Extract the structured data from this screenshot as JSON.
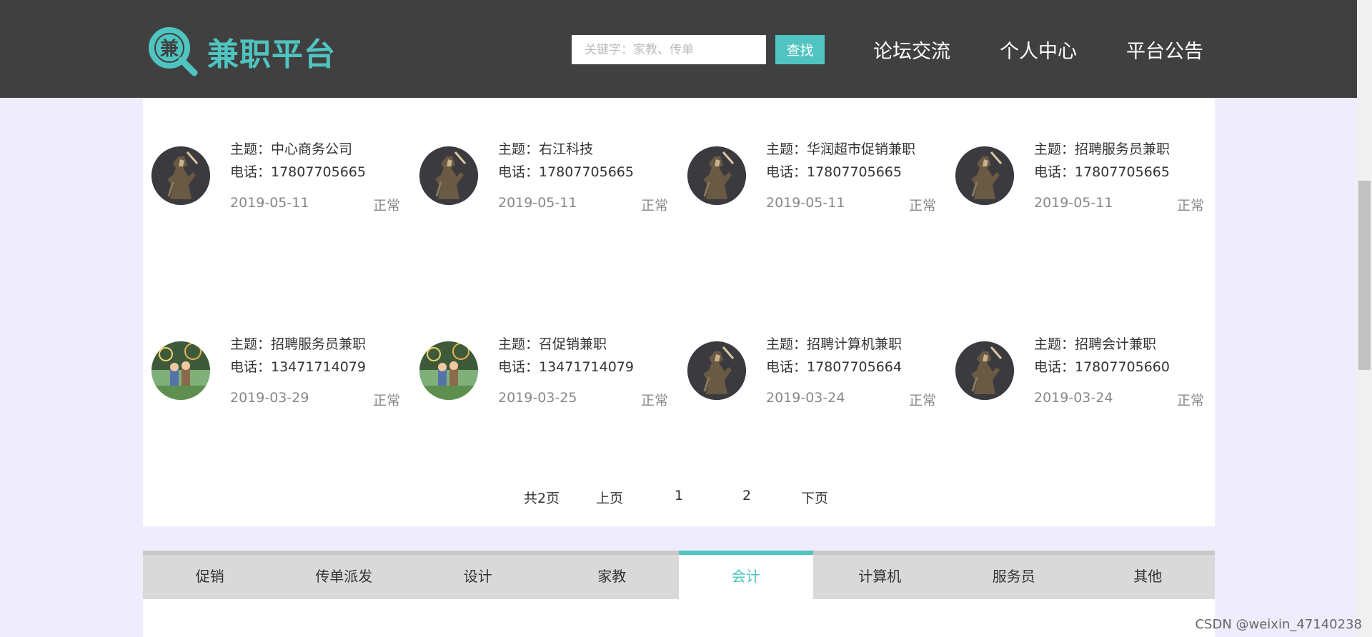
{
  "header": {
    "logo_char": "兼",
    "logo_text": "兼职平台",
    "search_placeholder": "关键字：家教、传单",
    "search_button": "查找",
    "nav": [
      "论坛交流",
      "个人中心",
      "平台公告"
    ]
  },
  "cards": [
    {
      "subject": "主题：中心商务公司",
      "phone": "电话：17807705665",
      "date": "2019-05-11",
      "status": "正常",
      "avatar": "warrior-avatar-icon"
    },
    {
      "subject": "主题：右江科技",
      "phone": "电话：17807705665",
      "date": "2019-05-11",
      "status": "正常",
      "avatar": "warrior-avatar-icon"
    },
    {
      "subject": "主题：华润超市促销兼职",
      "phone": "电话：17807705665",
      "date": "2019-05-11",
      "status": "正常",
      "avatar": "warrior-avatar-icon"
    },
    {
      "subject": "主题：招聘服务员兼职",
      "phone": "电话：17807705665",
      "date": "2019-05-11",
      "status": "正常",
      "avatar": "warrior-avatar-icon"
    },
    {
      "subject": "主题：招聘服务员兼职",
      "phone": "电话：13471714079",
      "date": "2019-03-29",
      "status": "正常",
      "avatar": "fireworks-avatar-icon"
    },
    {
      "subject": "主题：召促销兼职",
      "phone": "电话：13471714079",
      "date": "2019-03-25",
      "status": "正常",
      "avatar": "fireworks-avatar-icon"
    },
    {
      "subject": "主题：招聘计算机兼职",
      "phone": "电话：17807705664",
      "date": "2019-03-24",
      "status": "正常",
      "avatar": "warrior-avatar-icon"
    },
    {
      "subject": "主题：招聘会计兼职",
      "phone": "电话：17807705660",
      "date": "2019-03-24",
      "status": "正常",
      "avatar": "warrior-avatar-icon"
    }
  ],
  "pagination": {
    "total": "共2页",
    "prev": "上页",
    "pages": [
      "1",
      "2"
    ],
    "next": "下页"
  },
  "tabs": {
    "items": [
      "促销",
      "传单派发",
      "设计",
      "家教",
      "会计",
      "计算机",
      "服务员",
      "其他"
    ],
    "active": "会计"
  },
  "colors": {
    "header_bg": "#404040",
    "accent": "#4fc4c0",
    "page_bg": "#efedfd"
  },
  "watermark": "CSDN @weixin_47140238"
}
